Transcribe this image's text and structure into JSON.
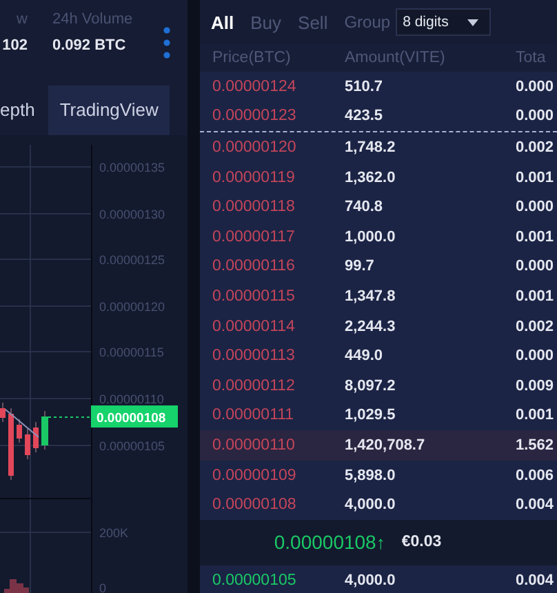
{
  "market_stats": [
    {
      "label": "w",
      "value": "102"
    },
    {
      "label": "24h Volume",
      "value": "0.092 BTC"
    }
  ],
  "chart_tabs": [
    {
      "label": "epth",
      "selected": false
    },
    {
      "label": "TradingView",
      "selected": true
    }
  ],
  "chart": {
    "price_labels": [
      "0.00000135",
      "0.00000130",
      "0.00000125",
      "0.00000120",
      "0.00000115",
      "0.00000110",
      "0.00000105"
    ],
    "last_price_tag": "0.00000108",
    "volume_labels": [
      "200K",
      "0"
    ]
  },
  "order_book": {
    "filters": [
      {
        "label": "All",
        "selected": true
      },
      {
        "label": "Buy",
        "selected": false
      },
      {
        "label": "Sell",
        "selected": false
      }
    ],
    "group_label": "Group",
    "group_value": "8 digits",
    "columns": [
      "Price(BTC)",
      "Amount(VITE)",
      "Tota"
    ],
    "asks": [
      {
        "price": "0.00000124",
        "amount": "510.7",
        "total": "0.000",
        "highlighted": false,
        "gap_above": false
      },
      {
        "price": "0.00000123",
        "amount": "423.5",
        "total": "0.000",
        "highlighted": false,
        "gap_above": false
      },
      {
        "price": "0.00000120",
        "amount": "1,748.2",
        "total": "0.002",
        "highlighted": false,
        "gap_above": true
      },
      {
        "price": "0.00000119",
        "amount": "1,362.0",
        "total": "0.001",
        "highlighted": false,
        "gap_above": false
      },
      {
        "price": "0.00000118",
        "amount": "740.8",
        "total": "0.000",
        "highlighted": false,
        "gap_above": false
      },
      {
        "price": "0.00000117",
        "amount": "1,000.0",
        "total": "0.001",
        "highlighted": false,
        "gap_above": false
      },
      {
        "price": "0.00000116",
        "amount": "99.7",
        "total": "0.000",
        "highlighted": false,
        "gap_above": false
      },
      {
        "price": "0.00000115",
        "amount": "1,347.8",
        "total": "0.001",
        "highlighted": false,
        "gap_above": false
      },
      {
        "price": "0.00000114",
        "amount": "2,244.3",
        "total": "0.002",
        "highlighted": false,
        "gap_above": false
      },
      {
        "price": "0.00000113",
        "amount": "449.0",
        "total": "0.000",
        "highlighted": false,
        "gap_above": false
      },
      {
        "price": "0.00000112",
        "amount": "8,097.2",
        "total": "0.009",
        "highlighted": false,
        "gap_above": false
      },
      {
        "price": "0.00000111",
        "amount": "1,029.5",
        "total": "0.001",
        "highlighted": false,
        "gap_above": false
      },
      {
        "price": "0.00000110",
        "amount": "1,420,708.7",
        "total": "1.562",
        "highlighted": true,
        "gap_above": false
      },
      {
        "price": "0.00000109",
        "amount": "5,898.0",
        "total": "0.006",
        "highlighted": false,
        "gap_above": false
      },
      {
        "price": "0.00000108",
        "amount": "4,000.0",
        "total": "0.004",
        "highlighted": false,
        "gap_above": false
      }
    ],
    "last_trade": {
      "price": "0.00000108",
      "arrow": "↑",
      "fiat": "€0.03"
    },
    "bids": [
      {
        "price": "0.00000105",
        "amount": "4,000.0",
        "total": "0.004",
        "highlighted": false,
        "gap_above": false
      }
    ]
  }
}
